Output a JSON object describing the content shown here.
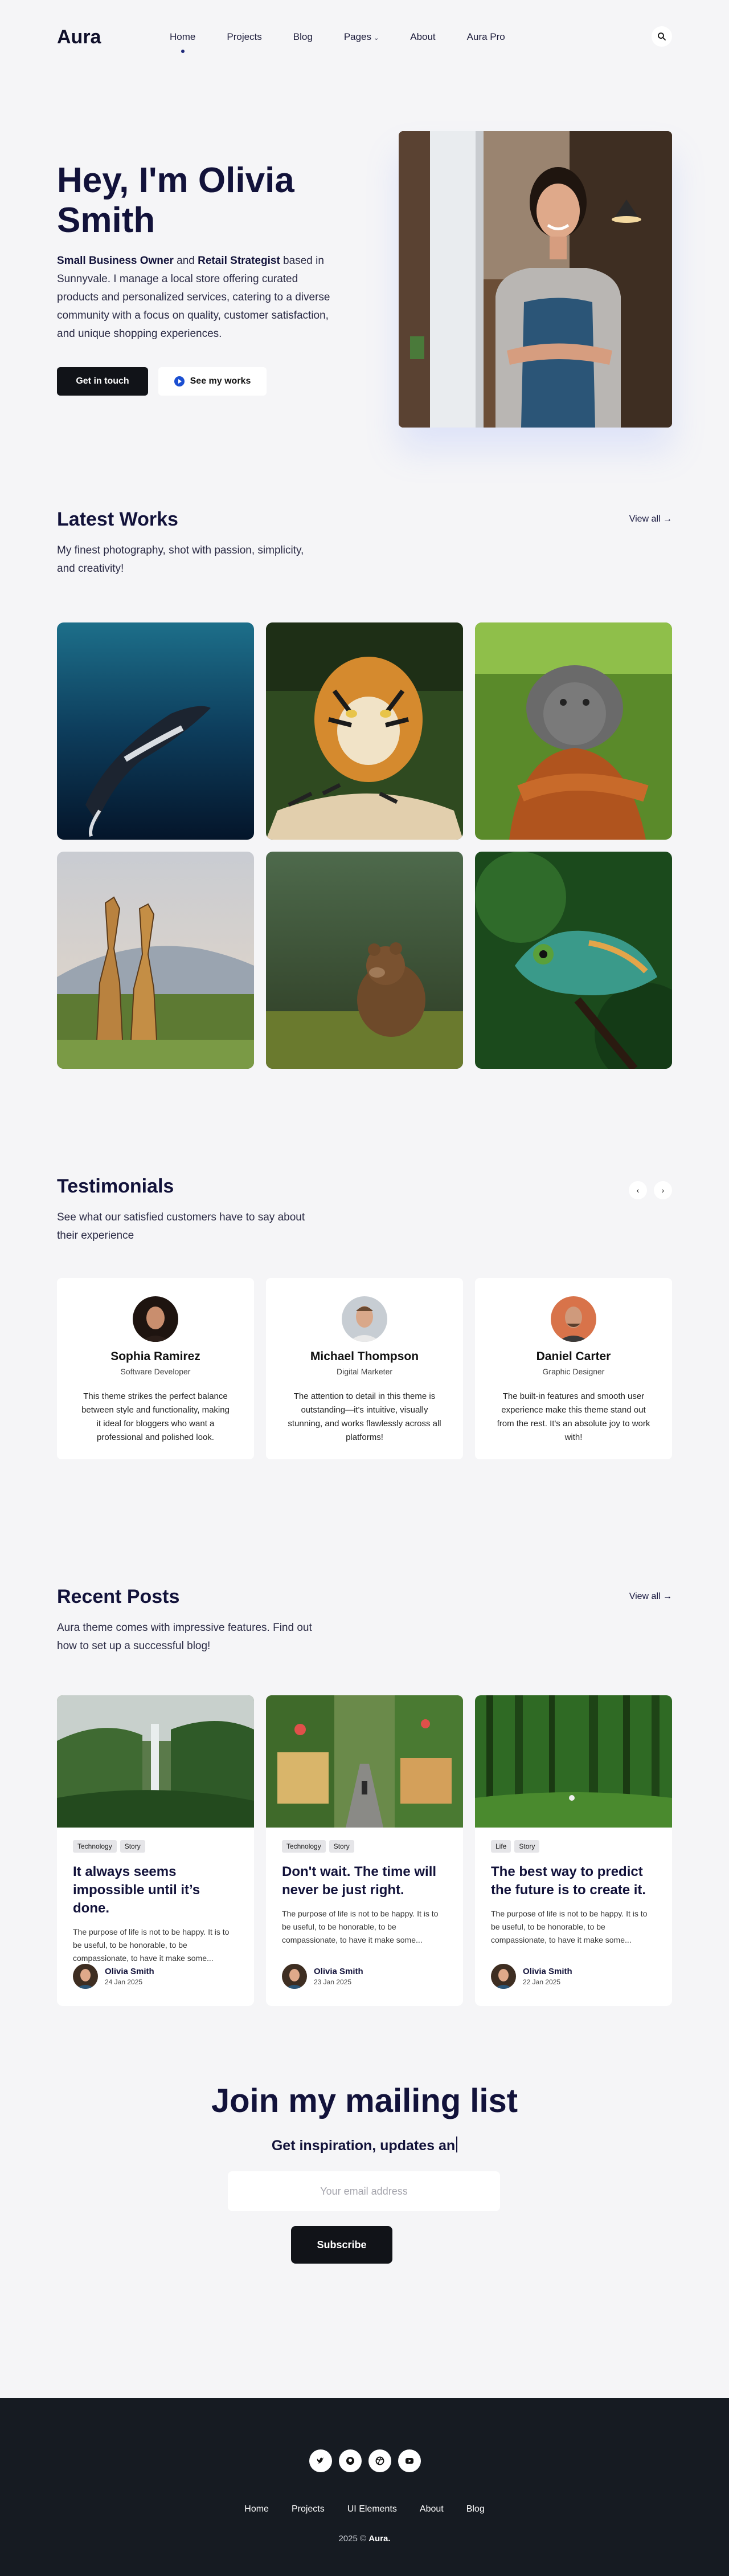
{
  "brand": {
    "logo": "Aura"
  },
  "nav": {
    "links": [
      "Home",
      "Projects",
      "Blog",
      "Pages",
      "About",
      "Aura Pro"
    ],
    "active": "Home"
  },
  "hero": {
    "title": "Hey, I'm Olivia Smith",
    "role_1": "Small Business Owner",
    "and": " and ",
    "role_2": "Retail Strategist",
    "description": " based in Sunnyvale. I manage a local store offering curated products and personalized services, catering to a diverse community with a focus on quality, customer satisfaction, and unique shopping experiences.",
    "primary_button": "Get in touch",
    "secondary_button": "See my works"
  },
  "works": {
    "title": "Latest Works",
    "subtitle": "My finest photography, shot with passion, simplicity, and creativity!",
    "view_all": "View all"
  },
  "testimonials": {
    "title": "Testimonials",
    "subtitle": "See what our satisfied customers have to say about their experience",
    "items": [
      {
        "name": "Sophia Ramirez",
        "role": "Software Developer",
        "text": "This theme strikes the perfect balance between style and functionality, making it ideal for bloggers who want a professional and polished look."
      },
      {
        "name": "Michael Thompson",
        "role": "Digital Marketer",
        "text": "The attention to detail in this theme is outstanding—it's intuitive, visually stunning, and works flawlessly across all platforms!"
      },
      {
        "name": "Daniel Carter",
        "role": "Graphic Designer",
        "text": "The built-in features and smooth user experience make this theme stand out from the rest. It's an absolute joy to work with!"
      }
    ]
  },
  "posts": {
    "title": "Recent Posts",
    "subtitle": "Aura theme comes with impressive features. Find out how to set up a successful blog!",
    "view_all": "View all",
    "items": [
      {
        "tags": [
          "Technology",
          "Story"
        ],
        "title": "It always seems impossible until it’s done.",
        "excerpt": "The purpose of life is not to be happy. It is to be useful, to be honorable, to be compassionate, to have it make some...",
        "author": "Olivia Smith",
        "date": "24 Jan 2025"
      },
      {
        "tags": [
          "Technology",
          "Story"
        ],
        "title": "Don't wait. The time will never be just right.",
        "excerpt": "The purpose of life is not to be happy. It is to be useful, to be honorable, to be compassionate, to have it make some...",
        "author": "Olivia Smith",
        "date": "23 Jan 2025"
      },
      {
        "tags": [
          "Life",
          "Story"
        ],
        "title": "The best way to predict the future is to create it.",
        "excerpt": "The purpose of life is not to be happy. It is to be useful, to be honorable, to be compassionate, to have it make some...",
        "author": "Olivia Smith",
        "date": "22 Jan 2025"
      }
    ]
  },
  "mailing": {
    "title": "Join my mailing list",
    "subtitle": "Get inspiration, updates an",
    "placeholder": "Your email address",
    "button": "Subscribe"
  },
  "footer": {
    "social_icons": [
      "twitter-icon",
      "github-icon",
      "dribbble-icon",
      "youtube-icon"
    ],
    "links": [
      "Home",
      "Projects",
      "UI Elements",
      "About",
      "Blog"
    ],
    "copyright_year": "2025 ©",
    "copyright_brand": "Aura."
  },
  "colors": {
    "background": "#f5f5f7",
    "text_dark": "#12123a",
    "button_dark": "#111318",
    "footer_bg": "#161b22",
    "accent_blue": "#1b4fd1"
  }
}
